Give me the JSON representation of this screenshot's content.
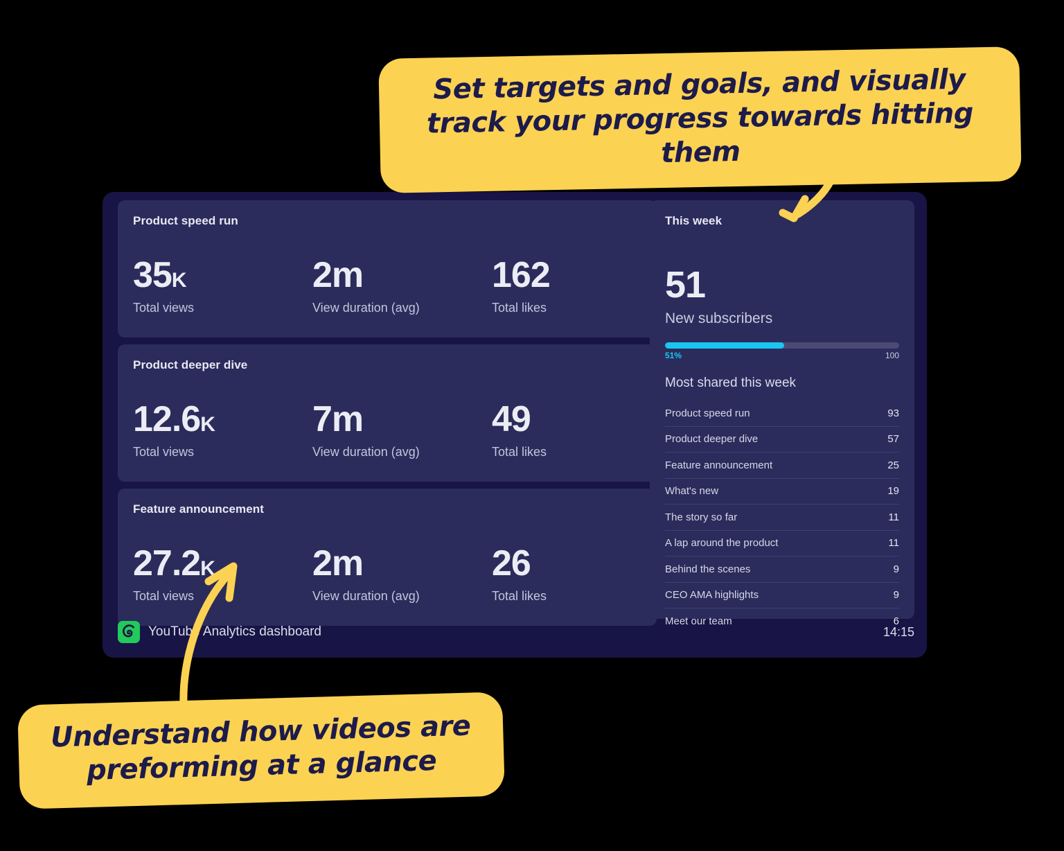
{
  "dashboard": {
    "video_cards": [
      {
        "title": "Product speed run",
        "metrics": [
          {
            "value": "35",
            "unit": "K",
            "label": "Total views"
          },
          {
            "value": "2m",
            "unit": "",
            "label": "View duration (avg)"
          },
          {
            "value": "162",
            "unit": "",
            "label": "Total likes"
          }
        ]
      },
      {
        "title": "Product deeper dive",
        "metrics": [
          {
            "value": "12.6",
            "unit": "K",
            "label": "Total views"
          },
          {
            "value": "7m",
            "unit": "",
            "label": "View duration (avg)"
          },
          {
            "value": "49",
            "unit": "",
            "label": "Total likes"
          }
        ]
      },
      {
        "title": "Feature announcement",
        "metrics": [
          {
            "value": "27.2",
            "unit": "K",
            "label": "Total views"
          },
          {
            "value": "2m",
            "unit": "",
            "label": "View duration (avg)"
          },
          {
            "value": "26",
            "unit": "",
            "label": "Total likes"
          }
        ]
      }
    ],
    "this_week": {
      "title": "This week",
      "subscribers_value": "51",
      "subscribers_label": "New subscribers",
      "progress": {
        "percent": 51,
        "percent_label": "51%",
        "max_label": "100",
        "fill_color": "#19c6f0",
        "track_color": "#4a4a73"
      },
      "most_shared_title": "Most shared this week",
      "most_shared": [
        {
          "name": "Product speed run",
          "count": "93"
        },
        {
          "name": "Product deeper dive",
          "count": "57"
        },
        {
          "name": "Feature announcement",
          "count": "25"
        },
        {
          "name": "What's new",
          "count": "19"
        },
        {
          "name": "The story so far",
          "count": "11"
        },
        {
          "name": "A lap around the product",
          "count": "11"
        },
        {
          "name": "Behind the scenes",
          "count": "9"
        },
        {
          "name": "CEO AMA highlights",
          "count": "9"
        },
        {
          "name": "Meet our team",
          "count": "6"
        }
      ]
    },
    "footer": {
      "logo_icon": "spiral-logo-icon",
      "title": "YouTube Analytics dashboard",
      "time": "14:15"
    },
    "colors": {
      "frame_bg": "#181445",
      "card_bg": "#2b2c5c",
      "accent_cyan": "#19c6f0",
      "logo_green": "#22c95b"
    }
  },
  "callouts": [
    {
      "id": "callout-top",
      "text": "Set targets and goals, and visually track your progress towards hitting them",
      "bg": "#fcd253",
      "fg": "#1d1b4b",
      "arrow": "curved-arrow-down-left-icon"
    },
    {
      "id": "callout-bottom",
      "text": "Understand how videos are preforming at a glance",
      "bg": "#fcd253",
      "fg": "#1d1b4b",
      "arrow": "curved-arrow-up-right-icon"
    }
  ]
}
